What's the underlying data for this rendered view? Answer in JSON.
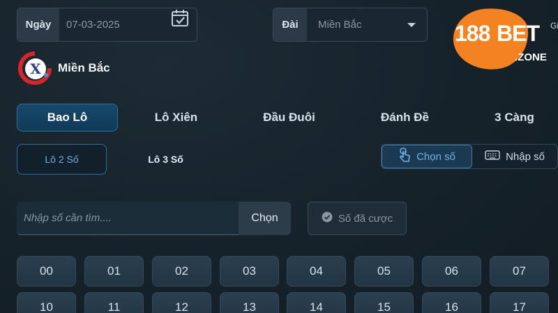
{
  "filters": {
    "date_label": "Ngày",
    "date_value": "07-03-2025",
    "station_label": "Đài",
    "station_value": "Miền Bắc",
    "edge_text": "Gi"
  },
  "logo": {
    "part1": "188",
    "part2": "BET",
    "part3": ".ZONE",
    "brand_color": "#f58220"
  },
  "region": {
    "title": "Miền Bắc",
    "icon": "region-x-icon"
  },
  "main_tabs": [
    {
      "label": "Bao Lô",
      "active": true
    },
    {
      "label": "Lô Xiên",
      "active": false
    },
    {
      "label": "Đầu Đuôi",
      "active": false
    },
    {
      "label": "Đánh Đề",
      "active": false
    },
    {
      "label": "3 Càng",
      "active": false
    }
  ],
  "sub_tabs": [
    {
      "label": "Lô 2 Số",
      "active": true
    },
    {
      "label": "Lô 3 Số",
      "active": false
    }
  ],
  "mode": {
    "pick_label": "Chọn số",
    "input_label": "Nhập số",
    "active": "pick"
  },
  "search": {
    "placeholder": "Nhập số cần tìm....",
    "button_label": "Chọn",
    "bet_label": "Số đã cược"
  },
  "numbers": [
    [
      "00",
      "01",
      "02",
      "03",
      "04",
      "05",
      "06",
      "07"
    ],
    [
      "10",
      "11",
      "12",
      "13",
      "14",
      "15",
      "16",
      "17"
    ]
  ],
  "colors": {
    "accent": "#2f6f9a",
    "active_text": "#6cb4ea",
    "background": "#16222a"
  }
}
